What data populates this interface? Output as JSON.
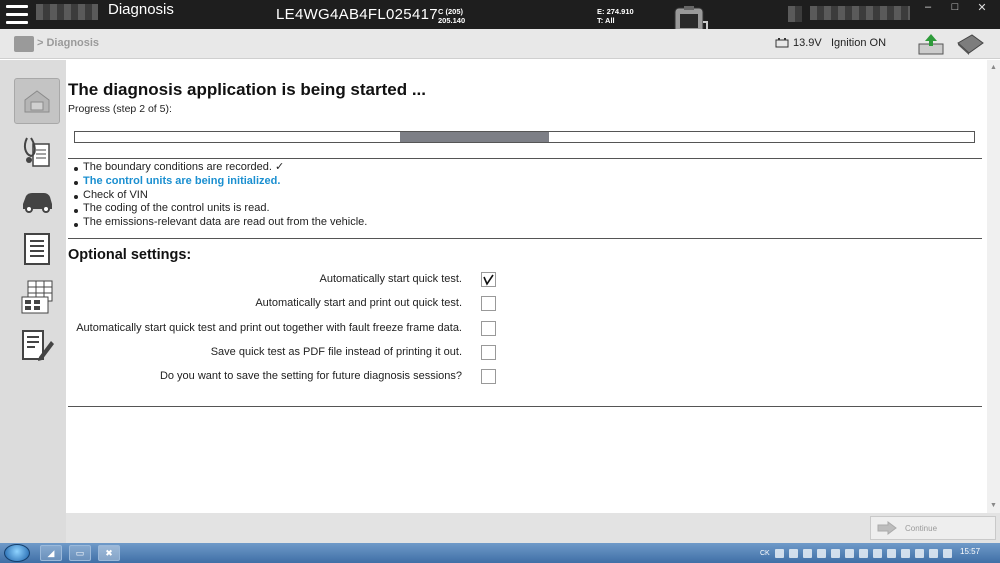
{
  "titlebar": {
    "app_title": "Diagnosis",
    "vin": "LE4WG4AB4FL025417",
    "c_line1": "C (205)",
    "c_line2": "205.140",
    "e_line1": "E: 274.910",
    "e_line2": "T: All",
    "minimize": "–",
    "maximize": "□",
    "close": "✕"
  },
  "header": {
    "breadcrumb": "> Diagnosis",
    "battery": "13.9V",
    "ignition": "Ignition ON"
  },
  "main": {
    "title": "The diagnosis application is being started ...",
    "progress_label": "Progress (step 2 of 5):",
    "progress": {
      "completed_fraction": 0.527,
      "step": 2,
      "total": 5
    },
    "steps": [
      {
        "label": "The boundary conditions are recorded. ✓",
        "active": false
      },
      {
        "label": "The control units are being initialized.",
        "active": true
      },
      {
        "label": "Check of VIN",
        "active": false
      },
      {
        "label": "The coding of the control units is read.",
        "active": false
      },
      {
        "label": "The emissions-relevant data are read out from the vehicle.",
        "active": false
      }
    ],
    "optional_heading": "Optional settings:",
    "options": [
      {
        "label": "Automatically start quick test.",
        "checked": true
      },
      {
        "label": "Automatically start and print out quick test.",
        "checked": false
      },
      {
        "label": "Automatically start quick test and print out together with fault freeze frame data.",
        "checked": false
      },
      {
        "label": "Save quick test as PDF file instead of printing it out.",
        "checked": false
      },
      {
        "label": "Do you want to save the setting for future diagnosis sessions?",
        "checked": false
      }
    ]
  },
  "footer": {
    "continue_label": "Continue"
  },
  "taskbar": {
    "lang": "CK",
    "clock": "15:57"
  },
  "colors": {
    "active_step": "#1a8fd0",
    "titlebar": "#1e1e1e",
    "progress_fill": "#7d7f86"
  }
}
